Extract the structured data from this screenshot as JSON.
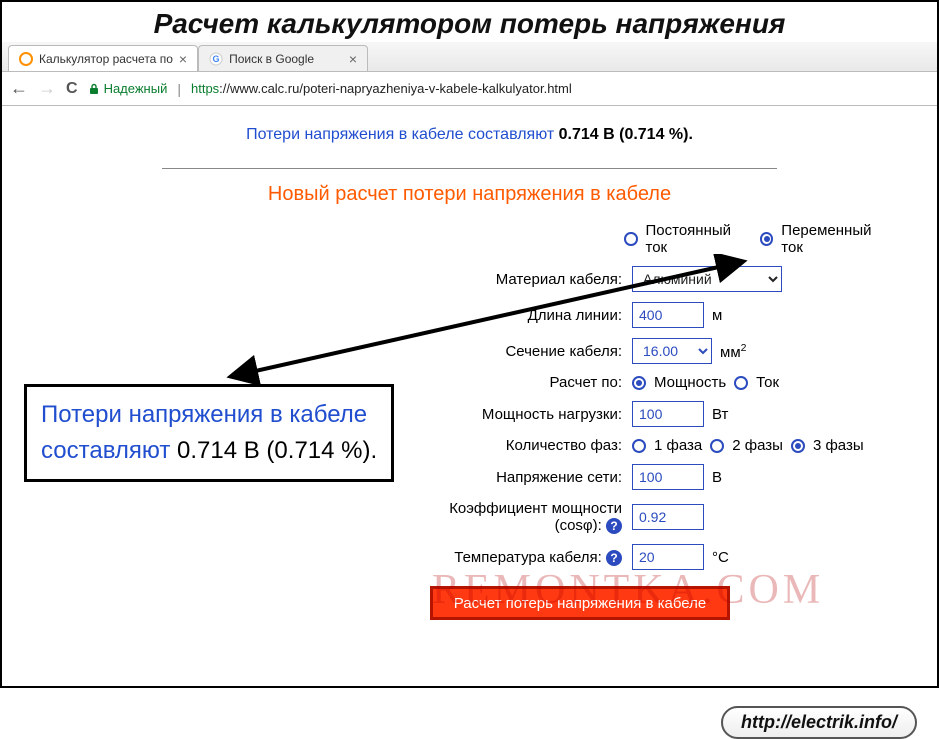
{
  "page_heading": "Расчет калькулятором потерь напряжения",
  "tabs": [
    {
      "label": "Калькулятор расчета по",
      "favicon_color": "#ff9000"
    },
    {
      "label": "Поиск в Google",
      "favicon": "G"
    }
  ],
  "address_bar": {
    "secure_text": "Надежный",
    "scheme": "https",
    "url_rest": "://www.calc.ru/poteri-napryazheniya-v-kabele-kalkulyator.html"
  },
  "result": {
    "label_text": "Потери напряжения в кабеле составляют ",
    "value_text": "0.714 В (0.714 %)."
  },
  "section_title": "Новый расчет потери напряжения в кабеле",
  "form": {
    "current_type": {
      "options": [
        "Постоянный ток",
        "Переменный ток"
      ],
      "selected": "Переменный ток"
    },
    "material": {
      "label": "Материал кабеля:",
      "value": "Алюминий"
    },
    "length": {
      "label": "Длина линии:",
      "value": "400",
      "unit": "м"
    },
    "section": {
      "label": "Сечение кабеля:",
      "value": "16.00",
      "unit_html": "мм",
      "unit_sup": "2"
    },
    "calc_by": {
      "label": "Расчет по:",
      "options": [
        "Мощность",
        "Ток"
      ],
      "selected": "Мощность"
    },
    "power": {
      "label": "Мощность нагрузки:",
      "value": "100",
      "unit": "Вт"
    },
    "phases": {
      "label": "Количество фаз:",
      "options": [
        "1 фаза",
        "2 фазы",
        "3 фазы"
      ],
      "selected": "3 фазы"
    },
    "voltage": {
      "label": "Напряжение сети:",
      "value": "100",
      "unit": "В"
    },
    "cosphi": {
      "label": "Коэффициент мощности (cosφ):",
      "value": "0.92"
    },
    "temp": {
      "label": "Температура кабеля:",
      "value": "20",
      "unit": "°С"
    },
    "submit_label": "Расчет потерь напряжения в кабеле"
  },
  "callout": {
    "label_text": "Потери напряжения в кабеле составляют ",
    "value_text": "0.714 В (0.714 %)."
  },
  "pill_text": "http://electrik.info/",
  "watermark": "REMONTKA.COM"
}
